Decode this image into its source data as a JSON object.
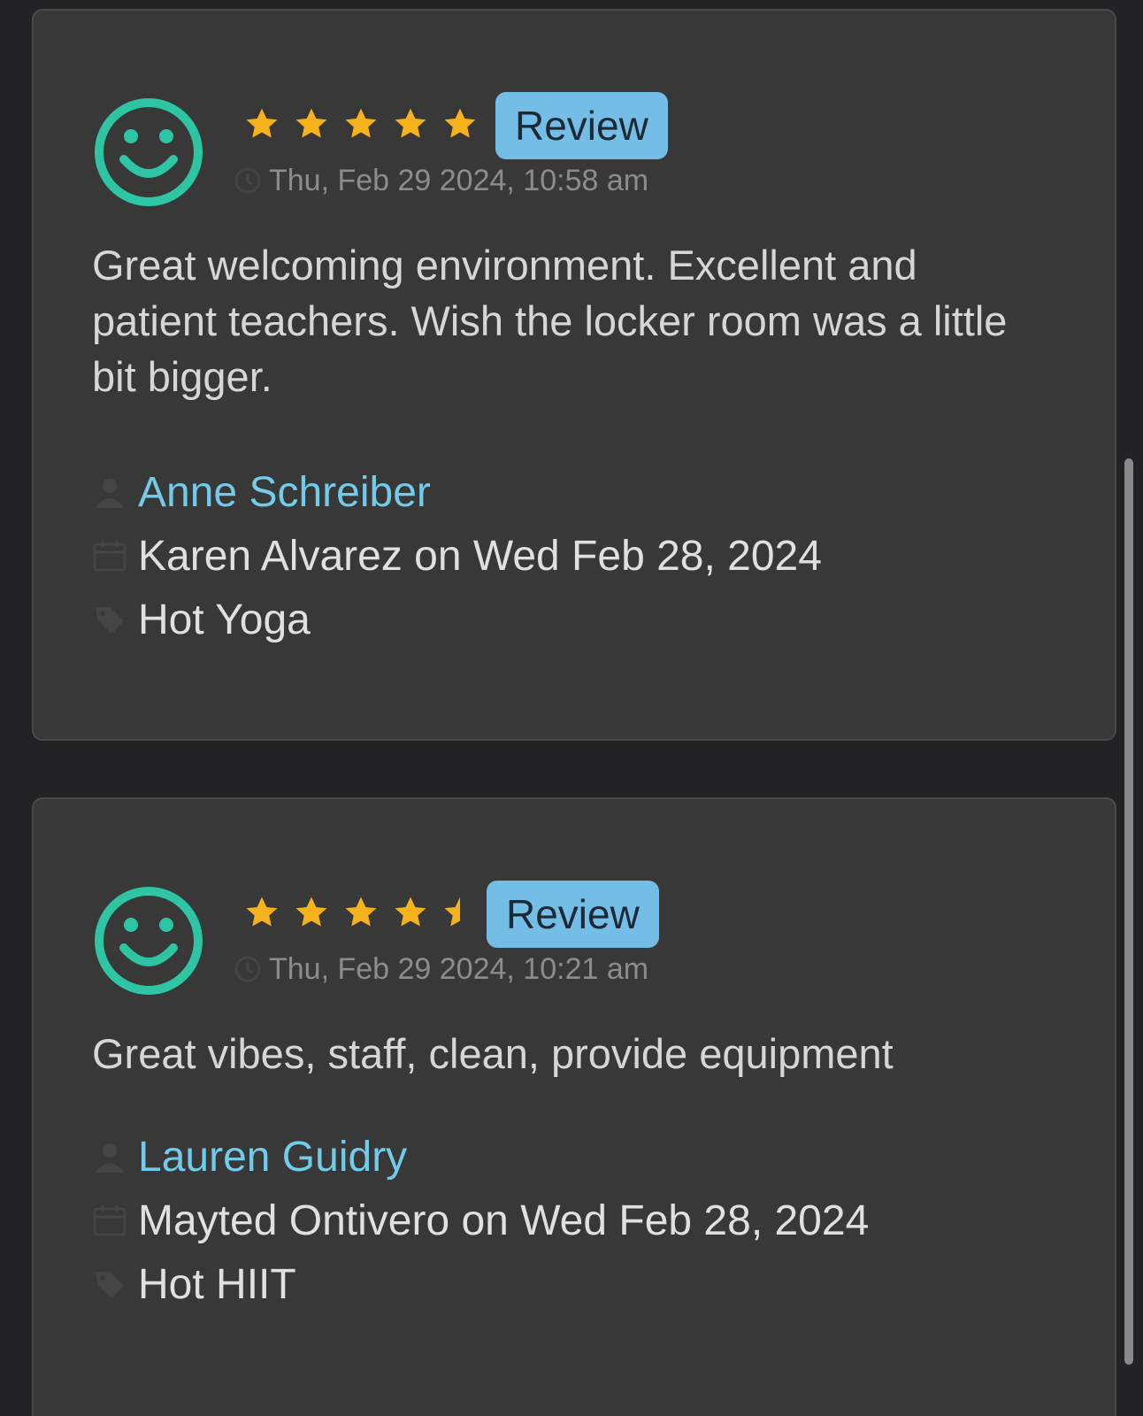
{
  "reviews": [
    {
      "rating": 5,
      "badge_label": "Review",
      "timestamp": "Thu, Feb 29 2024, 10:58 am",
      "text": "Great welcoming environment. Excellent and patient teachers. Wish the locker room was a little bit bigger.",
      "client_name": "Anne Schreiber",
      "class_info": "Karen Alvarez on Wed Feb 28, 2024",
      "class_name": "Hot Yoga"
    },
    {
      "rating": 4.5,
      "badge_label": "Review",
      "timestamp": "Thu, Feb 29 2024, 10:21 am",
      "text": "Great vibes, staff, clean, provide equipment",
      "client_name": "Lauren Guidry",
      "class_info": "Mayted Ontivero on Wed Feb 28, 2024",
      "class_name": "Hot HIIT"
    }
  ],
  "icons": {
    "avatar": "smiley-face-icon",
    "time": "clock-icon",
    "client": "person-icon",
    "class": "calendar-icon",
    "category": "tag-icon"
  },
  "colors": {
    "page_background": "#232325",
    "card_background": "#383838",
    "smiley": "#2dc5a3",
    "star": "#f6b21a",
    "badge_background": "#73bde6",
    "link": "#72cbe9"
  }
}
